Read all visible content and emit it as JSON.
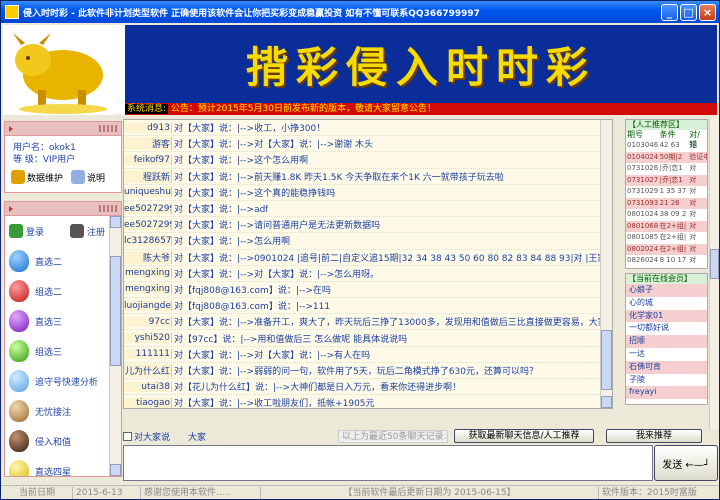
{
  "window": {
    "title": "侵入时时彩  -  此软件非计划类型软件      正确使用该软件会让你把买彩变成稳赢投资      如有不懂可联系QQ366799997",
    "min": "_",
    "max": "□",
    "close": "×"
  },
  "banner": {
    "title": "揹彩侵入时时彩",
    "notice_label": "系统消息:",
    "notice_text": " 公告：预计2015年5月30日前发布新的版本，敬请大家留意公告！"
  },
  "user": {
    "name_label": "用户名：",
    "name": "okok1",
    "level_label": "等  级：",
    "level": "VIP用户",
    "maintain": "数据维护",
    "help": "说明"
  },
  "menu": {
    "login": "登录",
    "register": "注册",
    "items": [
      "直选二",
      "组选二",
      "直选三",
      "组选三",
      "追守号快速分析",
      "无忧接注",
      "侵入和值",
      "直选四星"
    ]
  },
  "chat": {
    "rows": [
      {
        "name": "d913",
        "msg": "对【大家】说：|-->收工，小挣300！"
      },
      {
        "name": "游客",
        "msg": "对【大家】说：|-->对【大家】说：|-->谢谢 木头"
      },
      {
        "name": "feikof97",
        "msg": "对【大家】说：|-->这个怎么用啊"
      },
      {
        "name": "程跃新",
        "msg": "对【大家】说：|-->前天赚1.8K 昨天1.5K  今天争取在来个1K 六一就带孩子玩去啦"
      },
      {
        "name": "uniqueshui",
        "msg": "对【大家】说：|-->这个真的能稳挣钱吗"
      },
      {
        "name": "ee50272997",
        "msg": "对【大家】说：|-->adf"
      },
      {
        "name": "ee50272997",
        "msg": "对【大家】说：|-->请问普通用户是无法更新数据吗"
      },
      {
        "name": "lc3128657",
        "msg": "对【大家】说：|-->怎么用啊"
      },
      {
        "name": "陈大爷",
        "msg": "对【大家】说：|-->0901024    |追号|前二|自定义追15期|32 34 38 43 50 60 80 82 83 84 88 93|对      |王家龙"
      },
      {
        "name": "mengxing",
        "msg": "对【大家】说：|-->对【大家】说：|-->怎么用呀。"
      },
      {
        "name": "mengxing",
        "msg": "对【fqj808@163.com】说：|-->在吗"
      },
      {
        "name": "luojiangde",
        "msg": "对【fqj808@163.com】说：|-->111"
      },
      {
        "name": "97cc",
        "msg": "对【大家】说：|-->准备开工，爽大了，昨天玩后三挣了13000多，发现用和值做后三比直接做更容易，大家可以试"
      },
      {
        "name": "yshi520",
        "msg": "对【97cc】说：|-->用和值做后三  怎么做呢  能具体说说吗"
      },
      {
        "name": "111111",
        "msg": "对【大家】说：|-->对【大家】说：|-->有人在吗"
      },
      {
        "name": "儿为什么红",
        "msg": "对【大家】说：|-->弱弱的问一句，软件用了5天，玩后二角模式挣了630元，还算可以吗？"
      },
      {
        "name": "utai38",
        "msg": "对【花儿为什么红】说：|-->大神们都是日入万元，看来你还得进步啊！"
      },
      {
        "name": "tiaogao",
        "msg": "对【大家】说：|-->收工啦朋友们，抵帐+1905元"
      },
      {
        "name": "东海龙王",
        "msg": "对【大家】说：|-->+2.4k"
      }
    ],
    "to_all": "对大家说",
    "target": "大家",
    "history_hint": "以上为最近50条聊天记录...",
    "fetch_btn": "获取最新聊天信息/人工推荐",
    "recommend_btn": "我来推荐",
    "send_btn": "发送 ←—┘"
  },
  "recommend": {
    "title": "【人工推荐区】",
    "cols": [
      "期号",
      "条件",
      "对/错"
    ],
    "rows": [
      {
        "a": "0103046",
        "b": "42 63",
        "c": "对"
      },
      {
        "a": "0104024",
        "b": "50期|2",
        "c": "验证中"
      },
      {
        "a": "0731026",
        "b": "|乔|恋1",
        "c": "对"
      },
      {
        "a": "0731027",
        "b": "|乔|恋1",
        "c": "对"
      },
      {
        "a": "0731029",
        "b": "1 35 37",
        "c": "对"
      },
      {
        "a": "0731093",
        "b": "21 26",
        "c": "对"
      },
      {
        "a": "0801024",
        "b": "38 09 2",
        "c": "对"
      },
      {
        "a": "0801068",
        "b": "在2+组|",
        "c": "对"
      },
      {
        "a": "0801085",
        "b": "在2+组|",
        "c": "对"
      },
      {
        "a": "0802024",
        "b": "在2+组|",
        "c": "对"
      },
      {
        "a": "0826024",
        "b": "8 10 17",
        "c": "对"
      }
    ]
  },
  "members": {
    "title": "【当前在线会员】",
    "list": [
      "心娘子",
      "心的城",
      "化学家01",
      "一切都好说",
      "招顺",
      "一达",
      "石佛可肯",
      "子陵",
      "freyayi"
    ]
  },
  "status": {
    "date_label": "当前日期",
    "date": "2015-6-13",
    "thanks": "感谢您使用本软件.....",
    "update": "【当前软件最后更新日期为 2015-06-15】",
    "version": "软件版本：2015时富版"
  }
}
